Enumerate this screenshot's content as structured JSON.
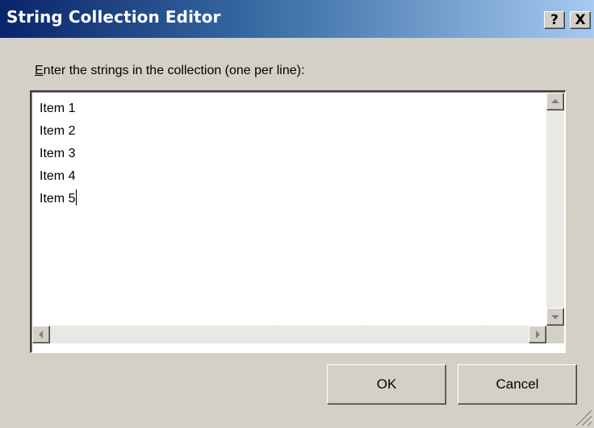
{
  "window": {
    "title": "String Collection Editor",
    "help_label": "?",
    "close_label": "X"
  },
  "prompt": {
    "mnemonic": "E",
    "rest": "nter the strings in the collection (one per line):"
  },
  "editor": {
    "lines": [
      "Item 1",
      "Item 2",
      "Item 3",
      "Item 4",
      "Item 5"
    ],
    "caret_after_line": 5
  },
  "buttons": {
    "ok_label": "OK",
    "cancel_label": "Cancel"
  },
  "colors": {
    "titlebar_start": "#0a246a",
    "titlebar_end": "#a6caf0",
    "face": "#d4d0c8"
  }
}
